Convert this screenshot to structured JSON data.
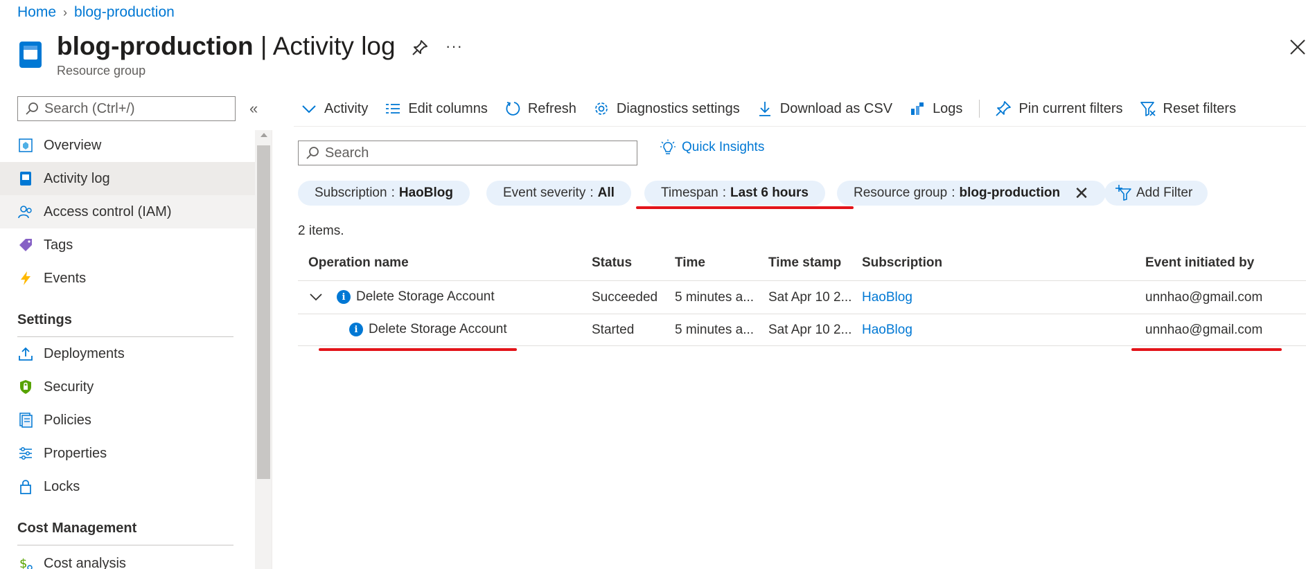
{
  "breadcrumb": {
    "home": "Home",
    "current": "blog-production"
  },
  "header": {
    "resource_name": "blog-production",
    "separator": " | ",
    "page_name": "Activity log",
    "subtitle": "Resource group",
    "more": "···"
  },
  "sidebar": {
    "search_placeholder": "Search (Ctrl+/)",
    "collapse": "«",
    "items": [
      {
        "label": "Overview",
        "icon": "overview-icon"
      },
      {
        "label": "Activity log",
        "icon": "activity-log-icon"
      },
      {
        "label": "Access control (IAM)",
        "icon": "iam-icon"
      },
      {
        "label": "Tags",
        "icon": "tag-icon"
      },
      {
        "label": "Events",
        "icon": "lightning-icon"
      }
    ],
    "sections": [
      {
        "title": "Settings",
        "items": [
          {
            "label": "Deployments",
            "icon": "upload-icon"
          },
          {
            "label": "Security",
            "icon": "shield-icon"
          },
          {
            "label": "Policies",
            "icon": "policy-icon"
          },
          {
            "label": "Properties",
            "icon": "sliders-icon"
          },
          {
            "label": "Locks",
            "icon": "lock-icon"
          }
        ]
      },
      {
        "title": "Cost Management",
        "items": [
          {
            "label": "Cost analysis",
            "icon": "cost-icon"
          }
        ]
      }
    ]
  },
  "toolbar": {
    "activity": "Activity",
    "edit_columns": "Edit columns",
    "refresh": "Refresh",
    "diagnostics": "Diagnostics settings",
    "download_csv": "Download as CSV",
    "logs": "Logs",
    "pin_filters": "Pin current filters",
    "reset_filters": "Reset filters"
  },
  "search": {
    "placeholder": "Search"
  },
  "quick_insights": "Quick Insights",
  "filters": [
    {
      "key": "Subscription",
      "value": "HaoBlog"
    },
    {
      "key": "Event severity",
      "value": "All"
    },
    {
      "key": "Timespan",
      "value": "Last 6 hours"
    },
    {
      "key": "Resource group",
      "value": "blog-production"
    }
  ],
  "filter_sep": " : ",
  "add_filter": "Add Filter",
  "item_count": "2 items.",
  "table": {
    "columns": [
      "Operation name",
      "Status",
      "Time",
      "Time stamp",
      "Subscription",
      "Event initiated by"
    ],
    "rows": [
      {
        "operation": "Delete Storage Account",
        "status": "Succeeded",
        "time": "5 minutes a...",
        "timestamp": "Sat Apr 10 2...",
        "subscription": "HaoBlog",
        "initiated_by": "unnhao@gmail.com"
      },
      {
        "operation": "Delete Storage Account",
        "status": "Started",
        "time": "5 minutes a...",
        "timestamp": "Sat Apr 10 2...",
        "subscription": "HaoBlog",
        "initiated_by": "unnhao@gmail.com"
      }
    ]
  },
  "colors": {
    "accent": "#0078d4",
    "annotation": "#e3141a",
    "pill_bg": "#e8f1fb"
  }
}
